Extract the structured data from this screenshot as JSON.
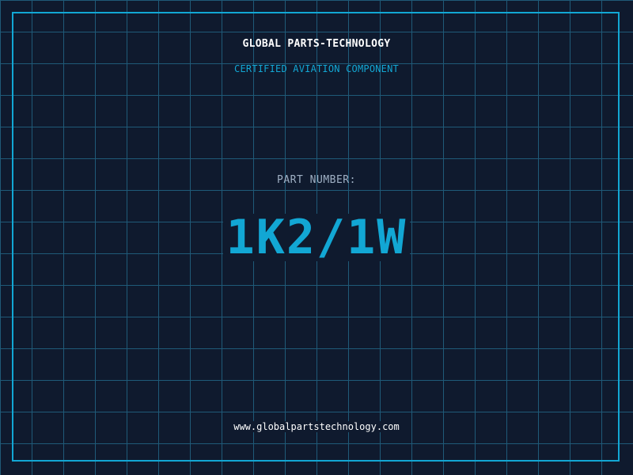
{
  "header": {
    "company_name": "GLOBAL PARTS-TECHNOLOGY",
    "tagline": "CERTIFIED AVIATION COMPONENT"
  },
  "part": {
    "label": "PART NUMBER:",
    "number": "1K2/1W"
  },
  "footer": {
    "website": "www.globalpartstechnology.com"
  },
  "colors": {
    "background": "#0f1a2e",
    "grid": "#1f5a78",
    "accent": "#12a7d4",
    "label": "#9fb0c4",
    "text": "#ffffff"
  }
}
